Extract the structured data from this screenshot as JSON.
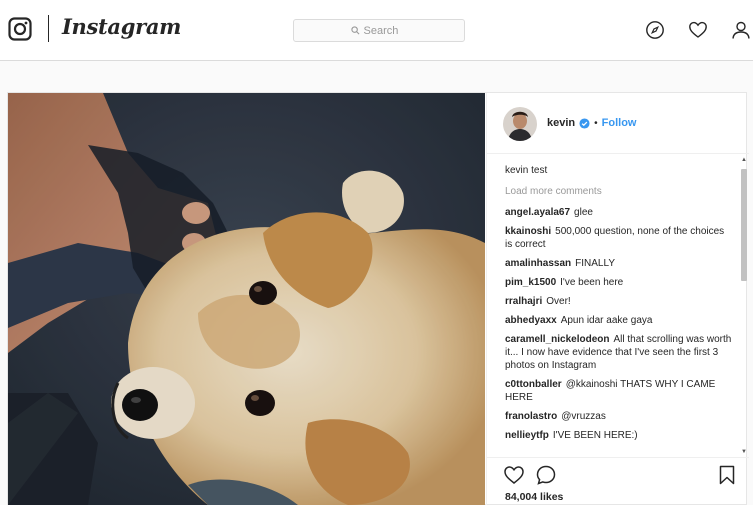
{
  "app": {
    "name": "Instagram"
  },
  "search": {
    "placeholder": "Search"
  },
  "nav_icons": [
    "explore-icon",
    "heart-icon",
    "profile-icon"
  ],
  "post": {
    "author": "kevin",
    "verified": true,
    "separator": "•",
    "follow_label": "Follow",
    "caption": "kevin test",
    "load_more": "Load more comments",
    "comments": [
      {
        "user": "angel.ayala67",
        "text": "glee"
      },
      {
        "user": "kkainoshi",
        "text": "500,000 question, none of the choices is correct"
      },
      {
        "user": "amalinhassan",
        "text": "FINALLY"
      },
      {
        "user": "pim_k1500",
        "text": "I've been here"
      },
      {
        "user": "rralhajri",
        "text": "Over!"
      },
      {
        "user": "abhedyaxx",
        "text": "Apun idar aake gaya"
      },
      {
        "user": "caramell_nickelodeon",
        "text": "All that scrolling was worth it... I now have evidence that I've seen the first 3 photos on Instagram"
      },
      {
        "user": "c0ttonballer",
        "text": "@kkainoshi THATS WHY I CAME HERE"
      },
      {
        "user": "franolastro",
        "text": "@vruzzas"
      },
      {
        "user": "nellieytfp",
        "text": "I'VE BEEN HERE:)"
      }
    ],
    "likes": "84,004 likes"
  },
  "colors": {
    "link": "#3897f0",
    "verified": "#3897f0",
    "border": "#dbdbdb"
  }
}
